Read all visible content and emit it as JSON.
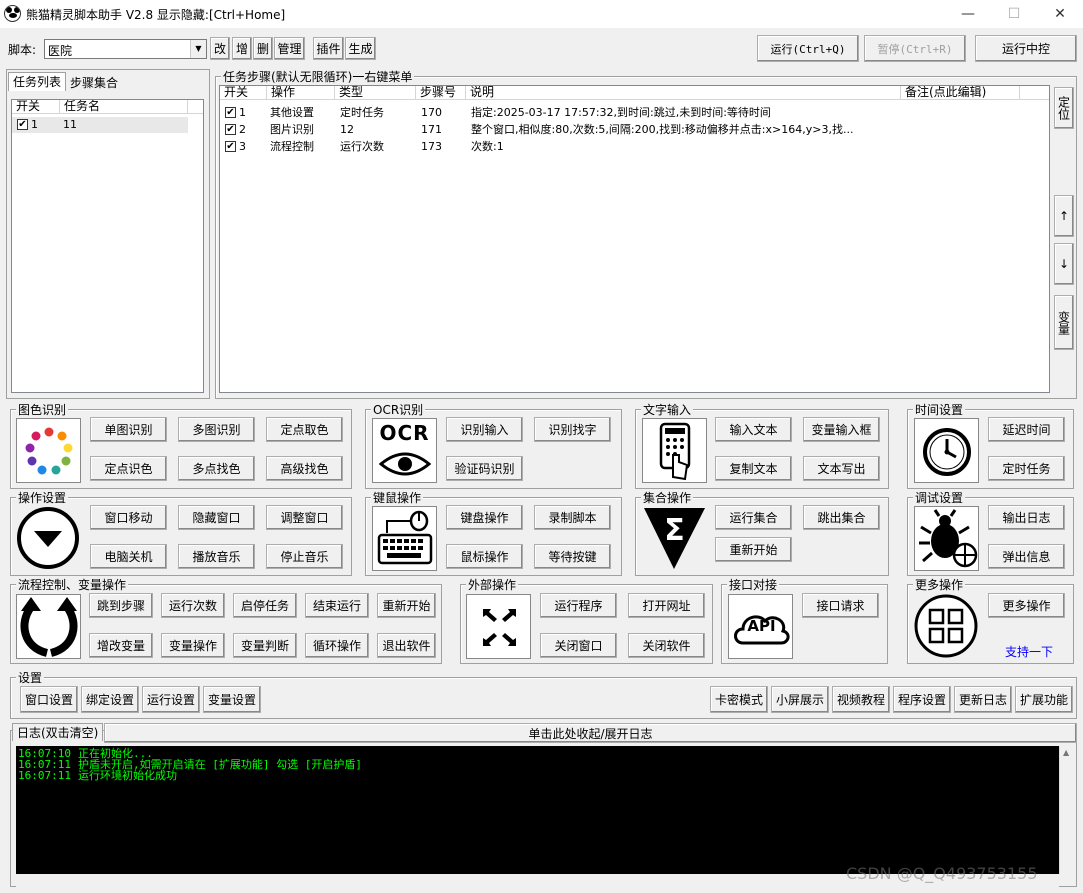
{
  "window": {
    "title": "熊猫精灵脚本助手 V2.8 显示隐藏:[Ctrl+Home]",
    "min": "—",
    "max": "☐",
    "close": "✕"
  },
  "toolbar": {
    "script_label": "脚本:",
    "script_value": "医院",
    "buttons": [
      "改",
      "增",
      "删",
      "管理",
      "插件",
      "生成"
    ],
    "run": "运行(Ctrl+Q)",
    "pause": "暂停(Ctrl+R)",
    "run_middle": "运行中控"
  },
  "left_panel": {
    "tabs": [
      "任务列表",
      "步骤集合"
    ],
    "headers": [
      "开关",
      "任务名"
    ],
    "rows": [
      {
        "id": "1",
        "name": "11",
        "checked": true
      }
    ]
  },
  "steps_panel": {
    "title": "任务步骤(默认无限循环)一右键菜单",
    "headers": [
      "开关",
      "操作",
      "类型",
      "步骤号",
      "说明",
      "备注(点此编辑)"
    ],
    "rows": [
      {
        "id": "1",
        "op": "其他设置",
        "type": "定时任务",
        "num": "170",
        "desc": "指定:2025-03-17 17:57:32,到时间:跳过,未到时间:等待时间",
        "note": ""
      },
      {
        "id": "2",
        "op": "图片识别",
        "type": "12",
        "num": "171",
        "desc": "整个窗口,相似度:80,次数:5,间隔:200,找到:移动偏移并点击:x>164,y>3,找...",
        "note": ""
      },
      {
        "id": "3",
        "op": "流程控制",
        "type": "运行次数",
        "num": "173",
        "desc": "次数:1",
        "note": ""
      }
    ],
    "side_buttons": [
      "定位",
      "↑",
      "↓",
      "变量"
    ]
  },
  "groups": {
    "color": {
      "title": "图色识别",
      "buttons": [
        "单图识别",
        "多图识别",
        "定点取色",
        "定点识色",
        "多点找色",
        "高级找色"
      ]
    },
    "ocr": {
      "title": "OCR识别",
      "icon_text": "OCR",
      "buttons": [
        "识别输入",
        "识别找字",
        "验证码识别"
      ]
    },
    "text": {
      "title": "文字输入",
      "buttons": [
        "输入文本",
        "变量输入框",
        "复制文本",
        "文本写出"
      ]
    },
    "time": {
      "title": "时间设置",
      "buttons": [
        "延迟时间",
        "定时任务"
      ]
    },
    "op": {
      "title": "操作设置",
      "buttons": [
        "窗口移动",
        "隐藏窗口",
        "调整窗口",
        "电脑关机",
        "播放音乐",
        "停止音乐"
      ]
    },
    "km": {
      "title": "键鼠操作",
      "buttons": [
        "键盘操作",
        "录制脚本",
        "鼠标操作",
        "等待按键"
      ]
    },
    "set": {
      "title": "集合操作",
      "icon_text": "Σ",
      "buttons": [
        "运行集合",
        "跳出集合",
        "重新开始"
      ]
    },
    "debug": {
      "title": "调试设置",
      "buttons": [
        "输出日志",
        "弹出信息"
      ]
    },
    "flow": {
      "title": "流程控制、变量操作",
      "buttons": [
        "跳到步骤",
        "运行次数",
        "启停任务",
        "结束运行",
        "重新开始",
        "增改变量",
        "变量操作",
        "变量判断",
        "循环操作",
        "退出软件"
      ]
    },
    "ext": {
      "title": "外部操作",
      "buttons": [
        "运行程序",
        "打开网址",
        "关闭窗口",
        "关闭软件"
      ]
    },
    "api": {
      "title": "接口对接",
      "icon_text": "API",
      "buttons": [
        "接口请求"
      ]
    },
    "more": {
      "title": "更多操作",
      "buttons": [
        "更多操作"
      ],
      "link": "支持一下"
    }
  },
  "settings": {
    "title": "设置",
    "left_buttons": [
      "窗口设置",
      "绑定设置",
      "运行设置",
      "变量设置"
    ],
    "right_buttons": [
      "卡密模式",
      "小屏展示",
      "视频教程",
      "程序设置",
      "更新日志",
      "扩展功能"
    ]
  },
  "log": {
    "tab": "日志(双击清空)",
    "toggle": "单击此处收起/展开日志",
    "lines": [
      {
        "time": "16:07:10",
        "text": "正在初始化..."
      },
      {
        "time": "16:07:11",
        "text": "护盾未开启,如需开启请在 [扩展功能] 勾选 [开启护盾]"
      },
      {
        "time": "16:07:11",
        "text": "运行环境初始化成功"
      }
    ]
  },
  "watermark": "CSDN @Q_Q493753155",
  "colors": {
    "log_bg": "#000000",
    "log_text": "#00ff00",
    "link": "#0000ff"
  }
}
